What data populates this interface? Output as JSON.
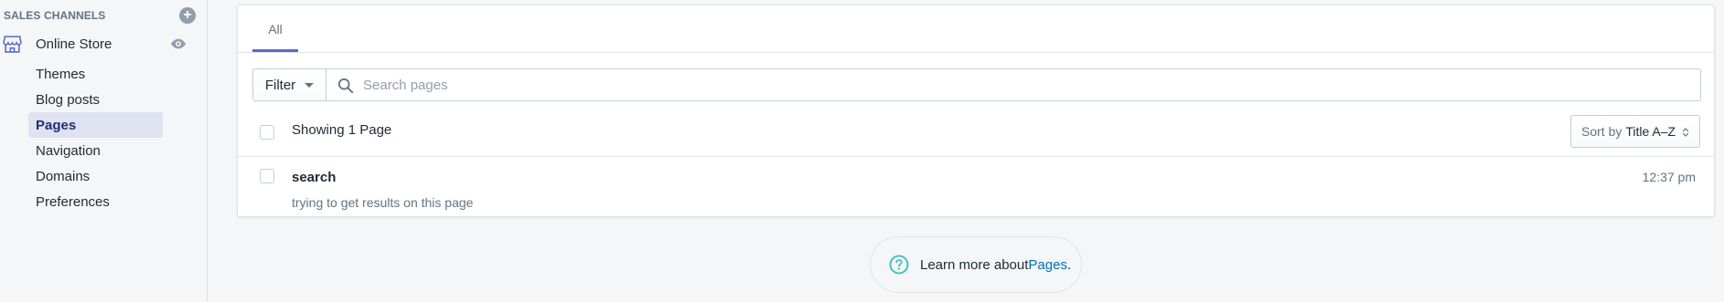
{
  "sidebar": {
    "section_title": "SALES CHANNELS",
    "add_icon": "plus-circle-icon",
    "online_store": {
      "label": "Online Store",
      "icon": "store-icon",
      "view_icon": "eye-icon"
    },
    "items": [
      {
        "label": "Themes",
        "active": false
      },
      {
        "label": "Blog posts",
        "active": false
      },
      {
        "label": "Pages",
        "active": true
      },
      {
        "label": "Navigation",
        "active": false
      },
      {
        "label": "Domains",
        "active": false
      },
      {
        "label": "Preferences",
        "active": false
      }
    ]
  },
  "tabs": [
    {
      "label": "All",
      "selected": true
    }
  ],
  "filter": {
    "button_label": "Filter",
    "search_placeholder": "Search pages",
    "search_value": ""
  },
  "list": {
    "showing_text": "Showing 1 Page",
    "sort_prefix": "Sort by",
    "sort_value": "Title A–Z",
    "rows": [
      {
        "title": "search",
        "description": "trying to get results on this page",
        "time": "12:37 pm"
      }
    ]
  },
  "help": {
    "text": "Learn more about ",
    "link": "Pages",
    "suffix": "."
  },
  "colors": {
    "accent": "#5c6ac4",
    "active_nav_bg": "#dfe3f1",
    "link": "#006fbb",
    "help_icon": "#47c1bf"
  }
}
